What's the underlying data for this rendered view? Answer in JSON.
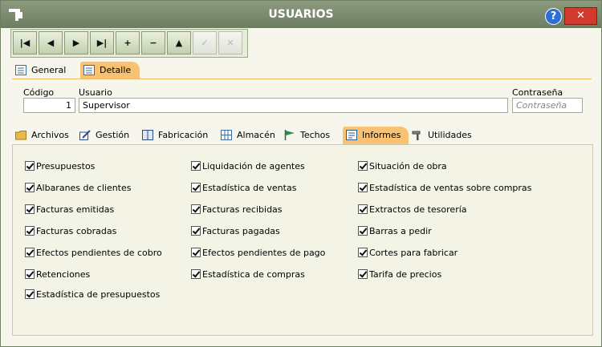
{
  "window": {
    "title": "USUARIOS",
    "help_label": "?",
    "close_label": "✕"
  },
  "toolbar": {
    "buttons": [
      {
        "name": "first-record",
        "glyph": "|◀"
      },
      {
        "name": "previous-record",
        "glyph": "◀"
      },
      {
        "name": "next-record",
        "glyph": "▶"
      },
      {
        "name": "last-record",
        "glyph": "▶|"
      },
      {
        "name": "add-record",
        "glyph": "+"
      },
      {
        "name": "delete-record",
        "glyph": "−"
      },
      {
        "name": "edit-record",
        "glyph": "▲"
      },
      {
        "name": "confirm",
        "glyph": "✓"
      },
      {
        "name": "cancel",
        "glyph": "✕"
      }
    ]
  },
  "main_tabs": {
    "general": "General",
    "detalle": "Detalle",
    "active": "Detalle"
  },
  "form": {
    "codigo_label": "Código",
    "codigo_value": "1",
    "usuario_label": "Usuario",
    "usuario_value": "Supervisor",
    "password_label": "Contraseña",
    "password_placeholder": "Contraseña"
  },
  "sub_tabs": {
    "archivos": "Archivos",
    "gestion": "Gestión",
    "fabricacion": "Fabricación",
    "almacen": "Almacén",
    "techos": "Techos",
    "informes": "Informes",
    "utilidades": "Utilidades",
    "active": "Informes"
  },
  "checkboxes": {
    "col1": [
      {
        "label": "Presupuestos",
        "checked": true
      },
      {
        "label": "Albaranes de clientes",
        "checked": true
      },
      {
        "label": "Facturas emitidas",
        "checked": true
      },
      {
        "label": "Facturas cobradas",
        "checked": true
      },
      {
        "label": "Efectos pendientes de cobro",
        "checked": true
      },
      {
        "label": "Retenciones",
        "checked": true
      },
      {
        "label": "Estadística de presupuestos",
        "checked": true
      }
    ],
    "col2": [
      {
        "label": "Liquidación de agentes",
        "checked": true
      },
      {
        "label": "Estadística de ventas",
        "checked": true
      },
      {
        "label": "Facturas recibidas",
        "checked": true
      },
      {
        "label": "Facturas pagadas",
        "checked": true
      },
      {
        "label": "Efectos pendientes de pago",
        "checked": true
      },
      {
        "label": "Estadística de compras",
        "checked": true
      }
    ],
    "col3": [
      {
        "label": "Situación de obra",
        "checked": true
      },
      {
        "label": "Estadística de ventas sobre compras",
        "checked": true
      },
      {
        "label": "Extractos de tesorería",
        "checked": true
      },
      {
        "label": "Barras a pedir",
        "checked": true
      },
      {
        "label": "Cortes para fabricar",
        "checked": true
      },
      {
        "label": "Tarifa de precios",
        "checked": true
      }
    ]
  }
}
